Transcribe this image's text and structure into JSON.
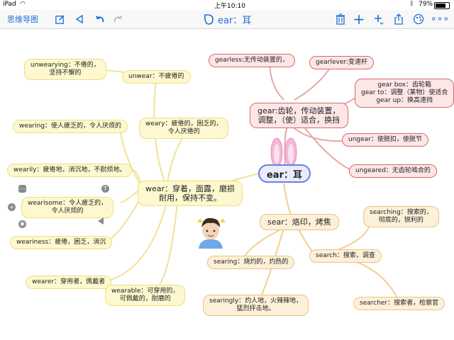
{
  "status_bar": {
    "device": "iPad",
    "time": "上午10:10",
    "battery": "79%"
  },
  "toolbar": {
    "app_title": "思维导图",
    "doc_title": "ear：耳",
    "icons": [
      "edit-icon",
      "back-triangle-icon",
      "undo-icon",
      "redo-icon",
      "trash-icon",
      "add-icon",
      "add-sibling-icon",
      "share-icon",
      "palette-icon",
      "more-icon"
    ]
  },
  "mindmap": {
    "center": "ear：耳",
    "nodes": {
      "unwearying": [
        "unwearying：不倦的，",
        "坚持不懈的"
      ],
      "unwear": [
        "unwear：不疲倦的"
      ],
      "weary": [
        "weary：疲倦的，困乏的，",
        "令人厌倦的"
      ],
      "wearing": [
        "wearing：使人疲乏的，令人厌烦的"
      ],
      "wearily": [
        "wearily：疲倦地，消沉地，不耐烦地。"
      ],
      "wearisome": [
        "wearisome：令人疲乏的，",
        "令人厌烦的"
      ],
      "weariness": [
        "weariness：疲倦，困乏，消沉"
      ],
      "wear": [
        "wear：穿着，面露，磨损",
        "耐用，保持不变。"
      ],
      "wearer": [
        "wearer：穿用者，佩戴者"
      ],
      "wearable": [
        "wearable：可穿用的，",
        "可佩戴的，耐磨的"
      ],
      "gearless": [
        "gearless:无传动装置的，"
      ],
      "gearlever": [
        "gearlever:变速杆"
      ],
      "gear": [
        "gear:齿轮，传动装置，",
        "调整，（使）适合，换挡"
      ],
      "gearbox": [
        "gear box：齿轮箱",
        "gear to：调整（某物）使适合",
        "gear up：换高速挡"
      ],
      "ungear": [
        "ungear：使脱扣，使脱节"
      ],
      "ungeared": [
        "ungeared：无齿轮啮合的"
      ],
      "sear": [
        "sear：烙印，烤焦"
      ],
      "searching": [
        "searching：搜索的，",
        "彻底的，锐利的"
      ],
      "search": [
        "search：搜索，调查"
      ],
      "searing": [
        "searing：烧灼的，灼热的"
      ],
      "searingly": [
        "searingly：灼人地，火辣辣地，",
        "猛烈抨击地。"
      ],
      "searcher": [
        "searcher：搜索者，检察官"
      ]
    },
    "floating_buttons": [
      "T",
      "+",
      "⋯",
      "✱"
    ]
  },
  "colors": {
    "accent": "#1d6fd6",
    "yellow_fill": "#fdf8cf",
    "red_border": "#d56a6a",
    "orange_fill": "#fdf0d9",
    "center_border": "#6b7ee6"
  }
}
